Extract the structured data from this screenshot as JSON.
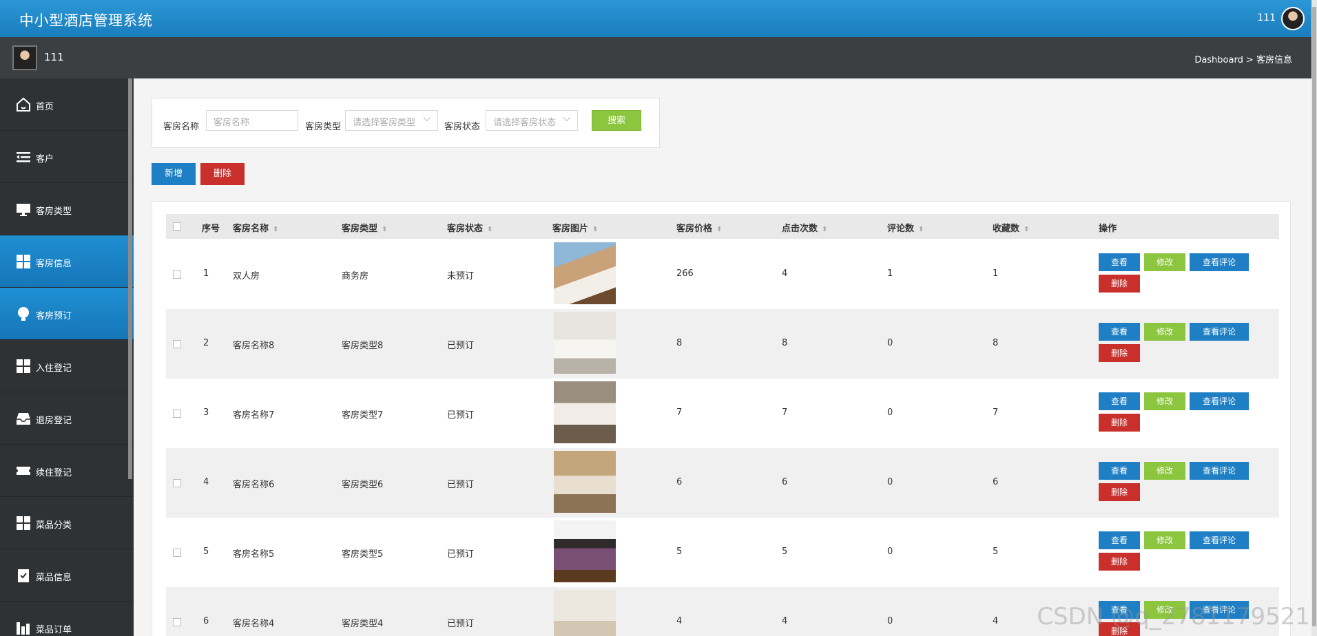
{
  "app": {
    "title": "中小型酒店管理系统",
    "user": "111"
  },
  "subheader": {
    "username": "111",
    "breadcrumb": "Dashboard > 客房信息"
  },
  "sidebar": {
    "items": [
      {
        "label": "首页",
        "icon": "home-icon",
        "active": false
      },
      {
        "label": "客户",
        "icon": "list-icon",
        "active": false
      },
      {
        "label": "客房类型",
        "icon": "monitor-icon",
        "active": false
      },
      {
        "label": "客房信息",
        "icon": "grid-icon",
        "active": true
      },
      {
        "label": "客房预订",
        "icon": "bulb-icon",
        "active": true
      },
      {
        "label": "入住登记",
        "icon": "grid-icon",
        "active": false
      },
      {
        "label": "退房登记",
        "icon": "inbox-icon",
        "active": false
      },
      {
        "label": "续住登记",
        "icon": "ticket-icon",
        "active": false
      },
      {
        "label": "菜品分类",
        "icon": "grid-icon",
        "active": false
      },
      {
        "label": "菜品信息",
        "icon": "clipboard-check-icon",
        "active": false
      },
      {
        "label": "菜品订单",
        "icon": "chart-icon",
        "active": false
      }
    ]
  },
  "search": {
    "name_label": "客房名称",
    "name_placeholder": "客房名称",
    "type_label": "客房类型",
    "type_placeholder": "请选择客房类型",
    "status_label": "客房状态",
    "status_placeholder": "请选择客房状态",
    "search_button": "搜索"
  },
  "toolbar": {
    "add_label": "新增",
    "delete_label": "删除"
  },
  "table": {
    "columns": [
      "序号",
      "客房名称",
      "客房类型",
      "客房状态",
      "客房图片",
      "客房价格",
      "点击次数",
      "评论数",
      "收藏数",
      "操作"
    ],
    "actions": {
      "view": "查看",
      "edit": "修改",
      "comments": "查看评论",
      "delete": "删除"
    },
    "rows": [
      {
        "no": "1",
        "name": "双人房",
        "type": "商务房",
        "status": "未预订",
        "price": "266",
        "clicks": "4",
        "comments": "1",
        "favorites": "1"
      },
      {
        "no": "2",
        "name": "客房名称8",
        "type": "客房类型8",
        "status": "已预订",
        "price": "8",
        "clicks": "8",
        "comments": "0",
        "favorites": "8"
      },
      {
        "no": "3",
        "name": "客房名称7",
        "type": "客房类型7",
        "status": "已预订",
        "price": "7",
        "clicks": "7",
        "comments": "0",
        "favorites": "7"
      },
      {
        "no": "4",
        "name": "客房名称6",
        "type": "客房类型6",
        "status": "已预订",
        "price": "6",
        "clicks": "6",
        "comments": "0",
        "favorites": "6"
      },
      {
        "no": "5",
        "name": "客房名称5",
        "type": "客房类型5",
        "status": "已预订",
        "price": "5",
        "clicks": "5",
        "comments": "0",
        "favorites": "5"
      },
      {
        "no": "6",
        "name": "客房名称4",
        "type": "客房类型4",
        "status": "已预订",
        "price": "4",
        "clicks": "4",
        "comments": "0",
        "favorites": "4"
      }
    ]
  },
  "watermark": "CSDN @q_2781179521"
}
